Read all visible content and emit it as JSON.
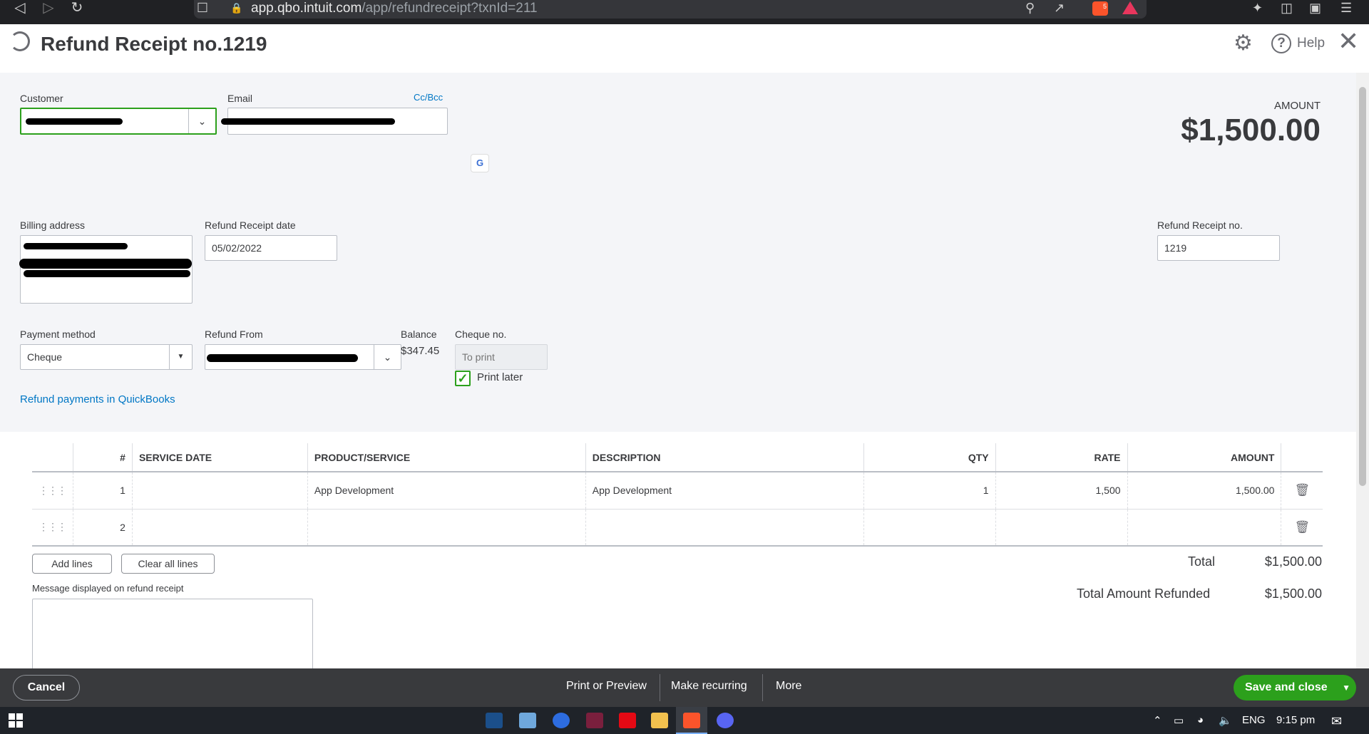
{
  "browser": {
    "url_main": "app.qbo.intuit.com",
    "url_path": "/app/refundreceipt?txnId=211",
    "ext_badge_count": "5"
  },
  "header": {
    "title": "Refund Receipt no.1219",
    "help_label": "Help"
  },
  "customer": {
    "label": "Customer"
  },
  "email": {
    "label": "Email",
    "cc_bcc": "Cc/Bcc"
  },
  "amount": {
    "label": "AMOUNT",
    "value": "$1,500.00"
  },
  "billing": {
    "label": "Billing address"
  },
  "refund_date": {
    "label": "Refund Receipt date",
    "value": "05/02/2022"
  },
  "receipt_no": {
    "label": "Refund Receipt no.",
    "value": "1219"
  },
  "payment_method": {
    "label": "Payment method",
    "value": "Cheque"
  },
  "refund_from": {
    "label": "Refund From"
  },
  "balance": {
    "label": "Balance",
    "value": "$347.45"
  },
  "cheque_no": {
    "label": "Cheque no.",
    "placeholder": "To print"
  },
  "print_later": {
    "label": "Print later",
    "checked": true
  },
  "refund_link": "Refund payments in QuickBooks",
  "table": {
    "headers": {
      "num": "#",
      "service_date": "SERVICE DATE",
      "product": "PRODUCT/SERVICE",
      "description": "DESCRIPTION",
      "qty": "QTY",
      "rate": "RATE",
      "amount": "AMOUNT"
    },
    "rows": [
      {
        "num": "1",
        "service_date": "",
        "product": "App Development",
        "description": "App Development",
        "qty": "1",
        "rate": "1,500",
        "amount": "1,500.00"
      },
      {
        "num": "2",
        "service_date": "",
        "product": "",
        "description": "",
        "qty": "",
        "rate": "",
        "amount": ""
      }
    ]
  },
  "buttons": {
    "add_lines": "Add lines",
    "clear_lines": "Clear all lines"
  },
  "message": {
    "label": "Message displayed on refund receipt"
  },
  "totals": {
    "total_label": "Total",
    "total_value": "$1,500.00",
    "refunded_label": "Total Amount Refunded",
    "refunded_value": "$1,500.00"
  },
  "footer": {
    "cancel": "Cancel",
    "print_preview": "Print or Preview",
    "make_recurring": "Make recurring",
    "more": "More",
    "save_close": "Save and close"
  },
  "taskbar": {
    "language": "ENG",
    "time": "9:15 pm"
  },
  "colors": {
    "accent_green": "#2ca01c",
    "link_blue": "#0077c5",
    "footer_bg": "#393a3d"
  }
}
